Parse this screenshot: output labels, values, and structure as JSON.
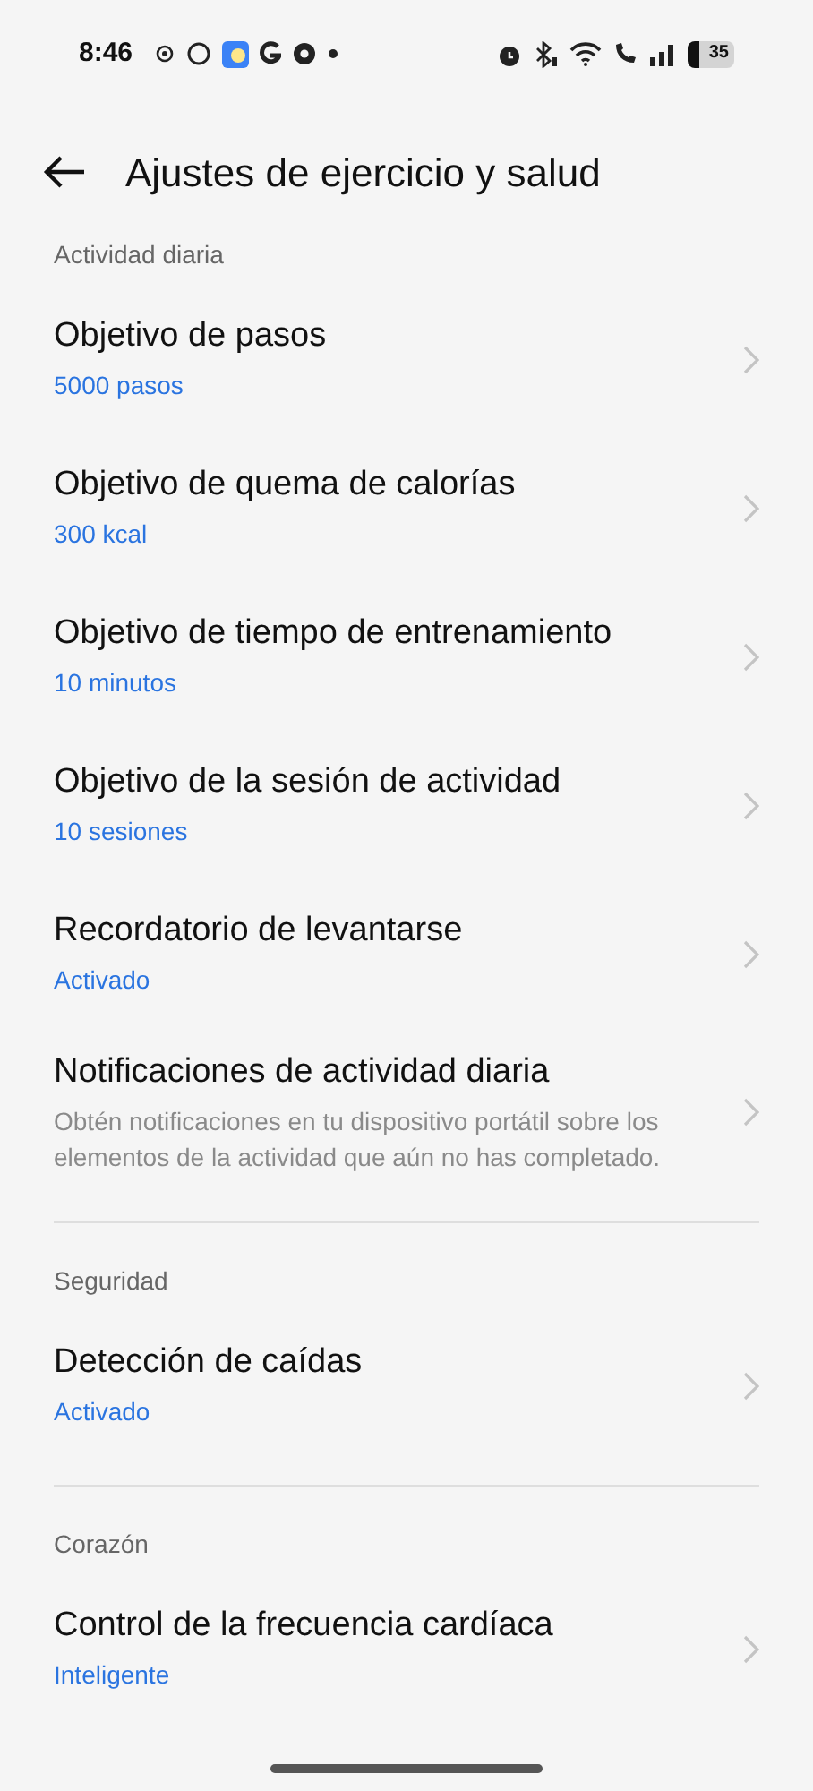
{
  "status_bar": {
    "time": "8:46",
    "battery": "35"
  },
  "header": {
    "title": "Ajustes de ejercicio y salud"
  },
  "sections": [
    {
      "label": "Actividad diaria",
      "items": [
        {
          "kind": "value",
          "title": "Objetivo de pasos",
          "text": "5000 pasos"
        },
        {
          "kind": "value",
          "title": "Objetivo de quema de calorías",
          "text": "300 kcal"
        },
        {
          "kind": "value",
          "title": "Objetivo de tiempo de entrenamiento",
          "text": "10 minutos"
        },
        {
          "kind": "value",
          "title": "Objetivo de la sesión de actividad",
          "text": "10 sesiones"
        },
        {
          "kind": "value",
          "title": "Recordatorio de levantarse",
          "text": "Activado"
        },
        {
          "kind": "description",
          "title": "Notificaciones de actividad diaria",
          "text": "Obtén notificaciones en tu dispositivo portátil sobre los elementos de la actividad que aún no has completado."
        }
      ]
    },
    {
      "label": "Seguridad",
      "items": [
        {
          "kind": "value",
          "title": "Detección de caídas",
          "text": "Activado"
        }
      ]
    },
    {
      "label": "Corazón",
      "items": [
        {
          "kind": "value",
          "title": "Control de la frecuencia cardíaca",
          "text": "Inteligente"
        }
      ]
    }
  ]
}
